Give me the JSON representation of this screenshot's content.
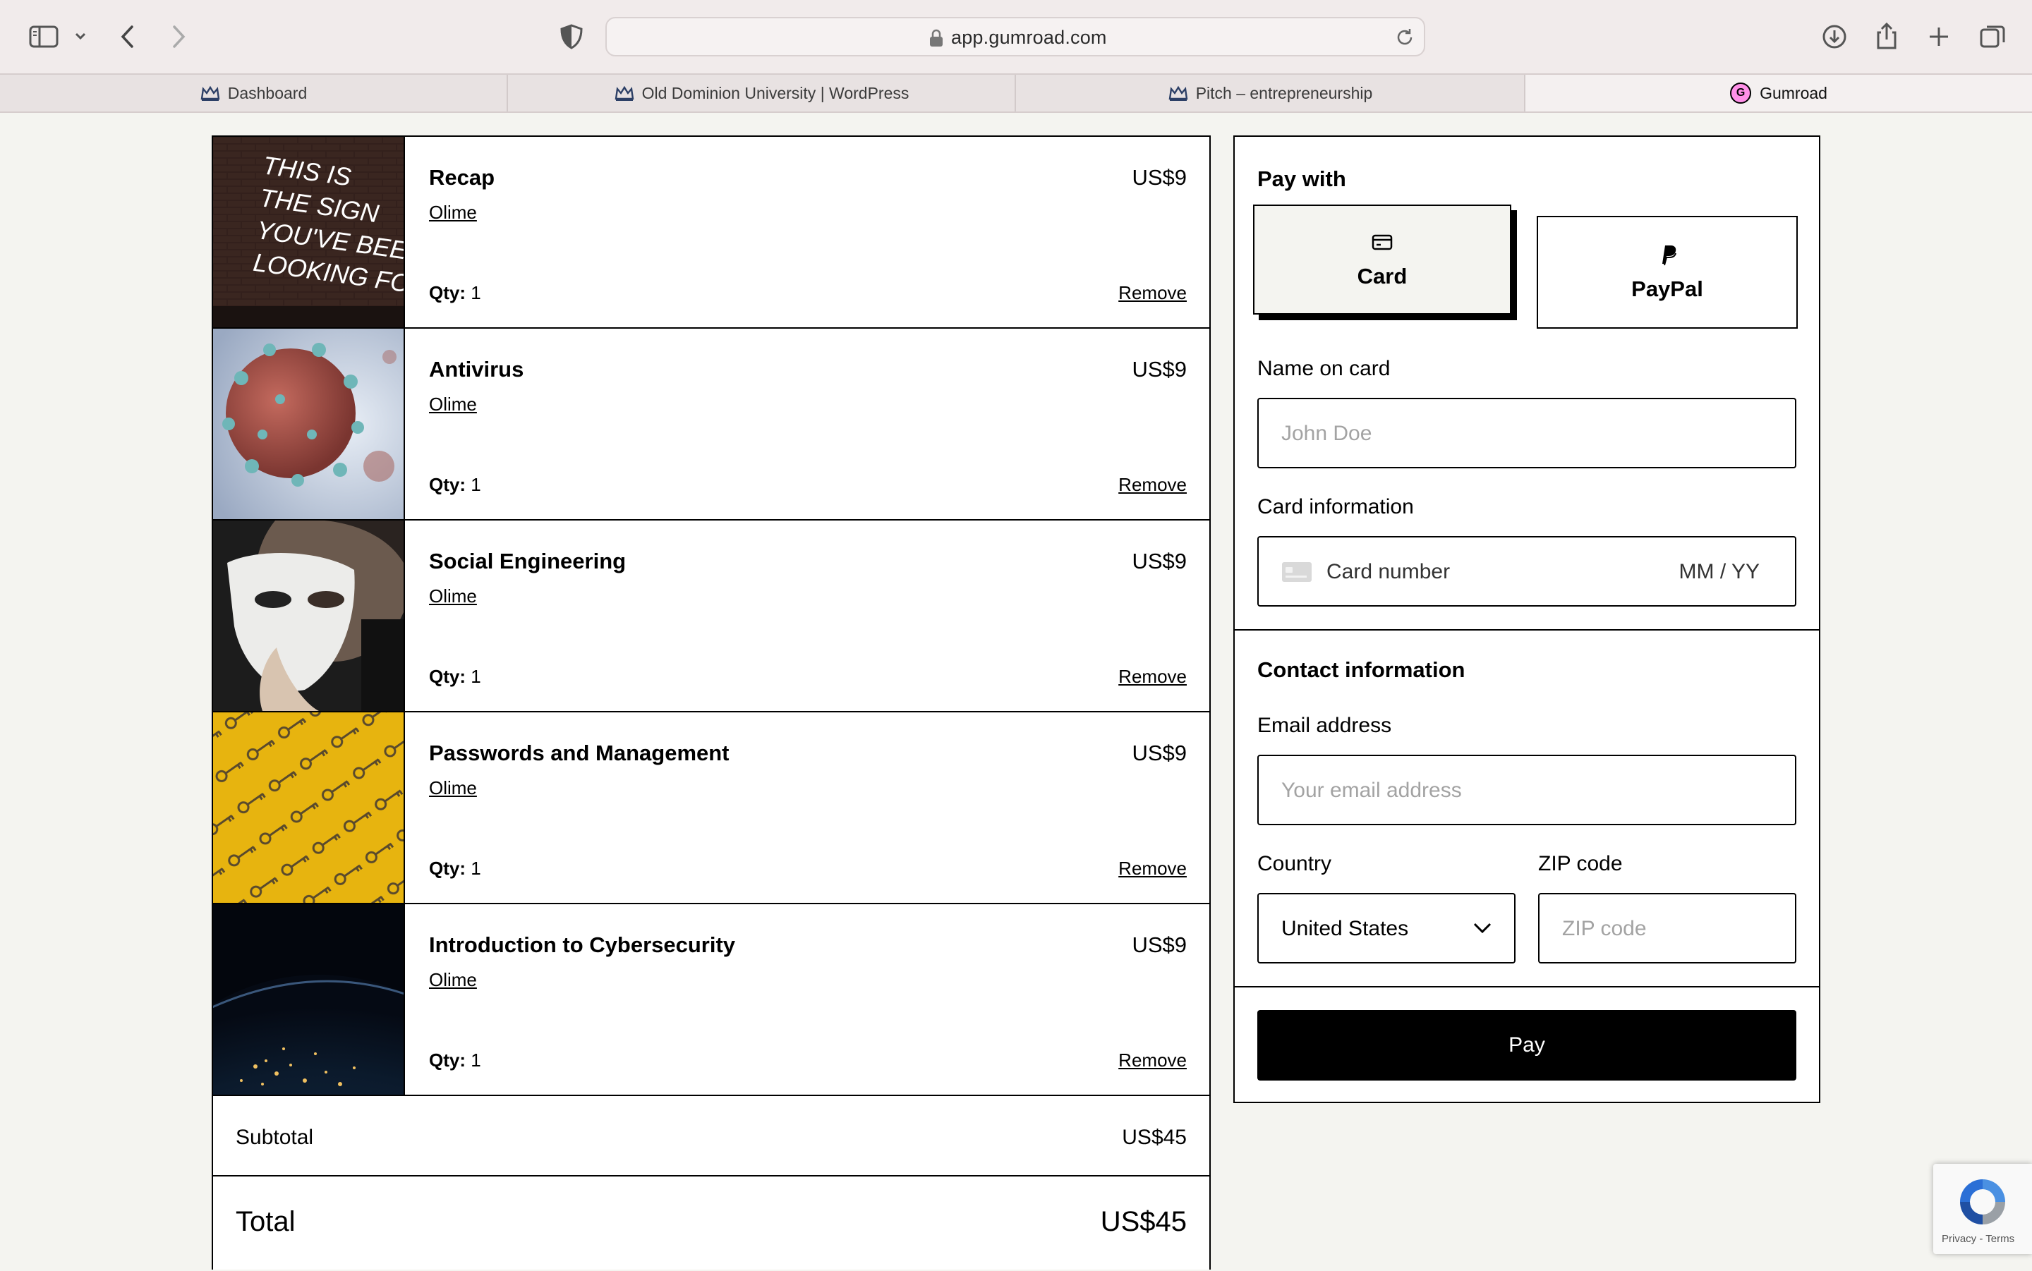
{
  "browser": {
    "url": "app.gumroad.com",
    "tabs": [
      {
        "label": "Dashboard",
        "icon": "crown-icon",
        "active": false
      },
      {
        "label": "Old Dominion University | WordPress",
        "icon": "crown-icon",
        "active": false
      },
      {
        "label": "Pitch – entrepreneurship",
        "icon": "crown-icon",
        "active": false
      },
      {
        "label": "Gumroad",
        "icon": "gumroad-g-icon",
        "active": true,
        "icon_text": "G"
      }
    ]
  },
  "cart": {
    "items": [
      {
        "title": "Recap",
        "price": "US$9",
        "seller": "Olime",
        "qty_label": "Qty:",
        "qty": "1",
        "remove": "Remove",
        "thumb_text": [
          "THIS IS",
          "THE SIGN",
          "YOU'VE BEEN",
          "LOOKING FOR"
        ]
      },
      {
        "title": "Antivirus",
        "price": "US$9",
        "seller": "Olime",
        "qty_label": "Qty:",
        "qty": "1",
        "remove": "Remove"
      },
      {
        "title": "Social Engineering",
        "price": "US$9",
        "seller": "Olime",
        "qty_label": "Qty:",
        "qty": "1",
        "remove": "Remove"
      },
      {
        "title": "Passwords and Management",
        "price": "US$9",
        "seller": "Olime",
        "qty_label": "Qty:",
        "qty": "1",
        "remove": "Remove"
      },
      {
        "title": "Introduction to Cybersecurity",
        "price": "US$9",
        "seller": "Olime",
        "qty_label": "Qty:",
        "qty": "1",
        "remove": "Remove"
      }
    ],
    "subtotal_label": "Subtotal",
    "subtotal_value": "US$45",
    "total_label": "Total",
    "total_value": "US$45"
  },
  "payment": {
    "title": "Pay with",
    "methods": [
      {
        "label": "Card",
        "icon": "credit-card-icon",
        "selected": true
      },
      {
        "label": "PayPal",
        "icon": "paypal-icon",
        "selected": false
      }
    ],
    "name_label": "Name on card",
    "name_placeholder": "John Doe",
    "card_label": "Card information",
    "card_number_placeholder": "Card number",
    "card_expiry_placeholder": "MM / YY",
    "contact_title": "Contact information",
    "email_label": "Email address",
    "email_placeholder": "Your email address",
    "country_label": "Country",
    "country_value": "United States",
    "zip_label": "ZIP code",
    "zip_placeholder": "ZIP code",
    "pay_label": "Pay"
  },
  "recaptcha": {
    "links": "Privacy - Terms"
  },
  "colors": {
    "accent_pink": "#ff90e8",
    "page_bg": "#f4f4f0",
    "button_bg": "#000000"
  }
}
